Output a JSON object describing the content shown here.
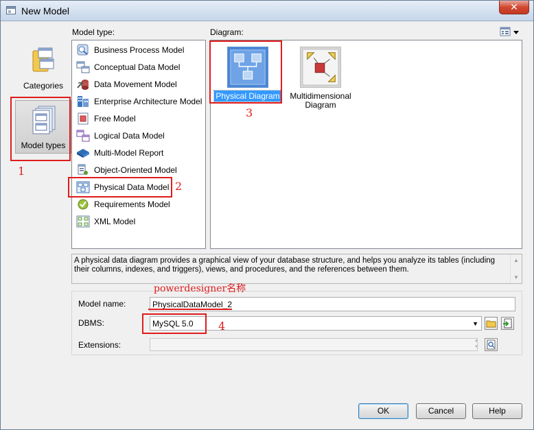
{
  "window": {
    "title": "New Model",
    "close_glyph": "✕"
  },
  "left_panel": {
    "items": [
      {
        "label": "Categories",
        "icon": "categories-icon"
      },
      {
        "label": "Model types",
        "icon": "model-types-icon"
      }
    ]
  },
  "labels": {
    "model_type": "Model type:",
    "diagram": "Diagram:"
  },
  "model_types": [
    {
      "label": "Business Process Model",
      "icon": "business-process-model-icon"
    },
    {
      "label": "Conceptual Data Model",
      "icon": "conceptual-data-model-icon"
    },
    {
      "label": "Data Movement Model",
      "icon": "data-movement-model-icon"
    },
    {
      "label": "Enterprise Architecture Model",
      "icon": "enterprise-architecture-model-icon"
    },
    {
      "label": "Free Model",
      "icon": "free-model-icon"
    },
    {
      "label": "Logical Data Model",
      "icon": "logical-data-model-icon"
    },
    {
      "label": "Multi-Model Report",
      "icon": "multi-model-report-icon"
    },
    {
      "label": "Object-Oriented Model",
      "icon": "object-oriented-model-icon"
    },
    {
      "label": "Physical Data Model",
      "icon": "physical-data-model-icon"
    },
    {
      "label": "Requirements Model",
      "icon": "requirements-model-icon"
    },
    {
      "label": "XML Model",
      "icon": "xml-model-icon"
    }
  ],
  "diagrams": [
    {
      "label": "Physical Diagram",
      "icon": "physical-diagram-icon"
    },
    {
      "label": "Multidimensional Diagram",
      "icon": "multidimensional-diagram-icon"
    }
  ],
  "description": "A physical data diagram provides a graphical view of your database structure, and helps you analyze its tables (including their columns, indexes, and triggers), views, and procedures, and the references between them.",
  "form": {
    "model_name_label": "Model name:",
    "model_name_value": "PhysicalDataModel_2",
    "dbms_label": "DBMS:",
    "dbms_value": "MySQL 5.0",
    "extensions_label": "Extensions:"
  },
  "annotations": {
    "n1": "1",
    "n2": "2",
    "n3": "3",
    "n4": "4",
    "powerdesigner_note": "powerdesigner名称",
    "color": "#e01b1b"
  },
  "buttons": {
    "ok": "OK",
    "cancel": "Cancel",
    "help": "Help"
  },
  "colors": {
    "selection": "#3399ff",
    "title_bar": "#d3e0ef"
  }
}
